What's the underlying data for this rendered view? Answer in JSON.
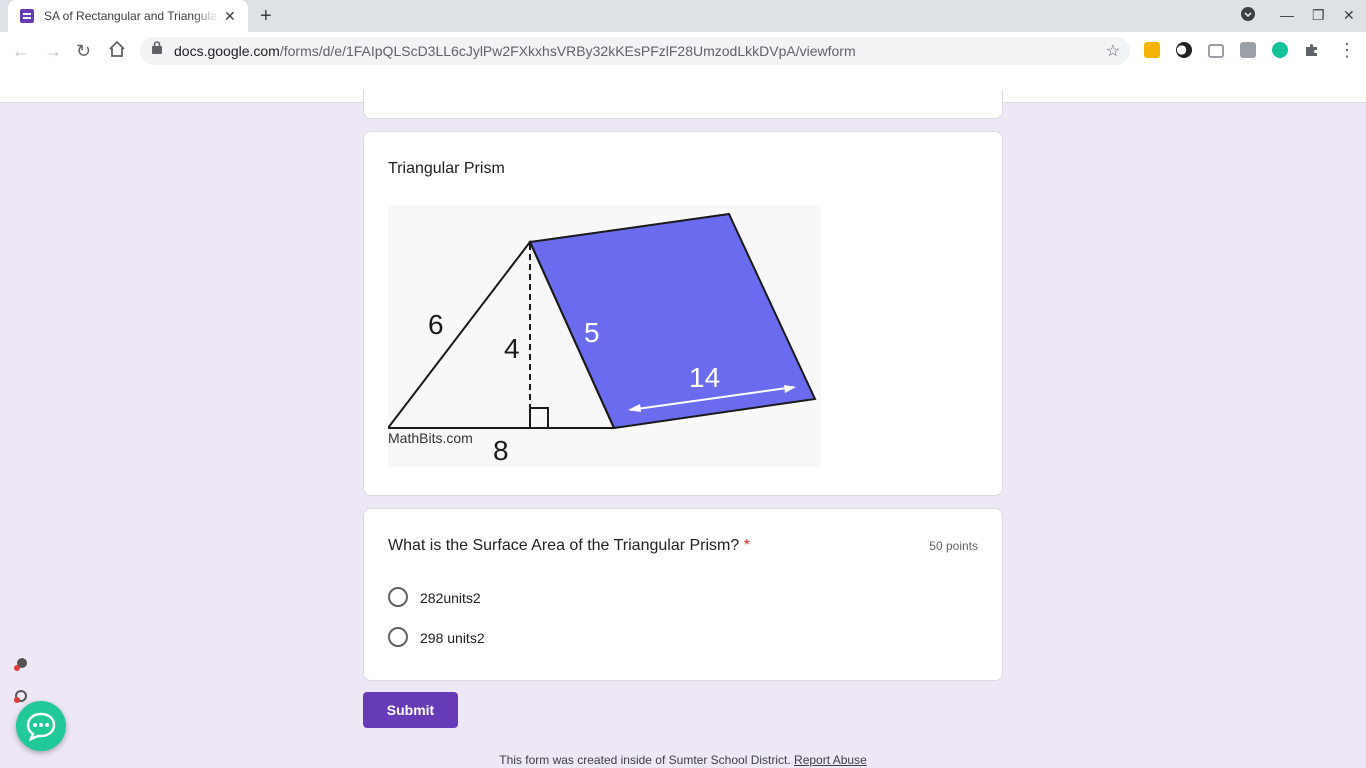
{
  "browser": {
    "tab_title": "SA of Rectangular and Triangular Prisms",
    "new_tab_label": "+",
    "url_host": "docs.google.com",
    "url_path": "/forms/d/e/1FAIpQLScD3LL6cJylPw2FXkxhsVRBy32kKEsPFzlF28UmzodLkkDVpA/viewform",
    "nav_icons": [
      "back-icon",
      "forward-icon",
      "reload-icon",
      "home-icon"
    ],
    "extension_icons": [
      "classroom-icon",
      "dark-mode-icon",
      "screenshot-icon",
      "tab-icon",
      "grammarly-icon",
      "puzzle-icon"
    ]
  },
  "section": {
    "title": "Triangular Prism",
    "figure": {
      "watermark": "MathBits.com",
      "labels": {
        "slant": "6",
        "height": "4",
        "side": "5",
        "length": "14",
        "base": "8"
      },
      "fill_color": "#6b6bef"
    }
  },
  "question": {
    "title": "What is the Surface Area of the Triangular Prism?",
    "required_mark": "*",
    "points": "50 points",
    "options": [
      "282units2",
      "298 units2"
    ]
  },
  "submit_label": "Submit",
  "footer": {
    "text": "This form was created inside of Sumter School District.",
    "report_link": "Report Abuse"
  },
  "colors": {
    "accent": "#673ab7",
    "background": "#ede7f6",
    "chat": "#20c997"
  }
}
